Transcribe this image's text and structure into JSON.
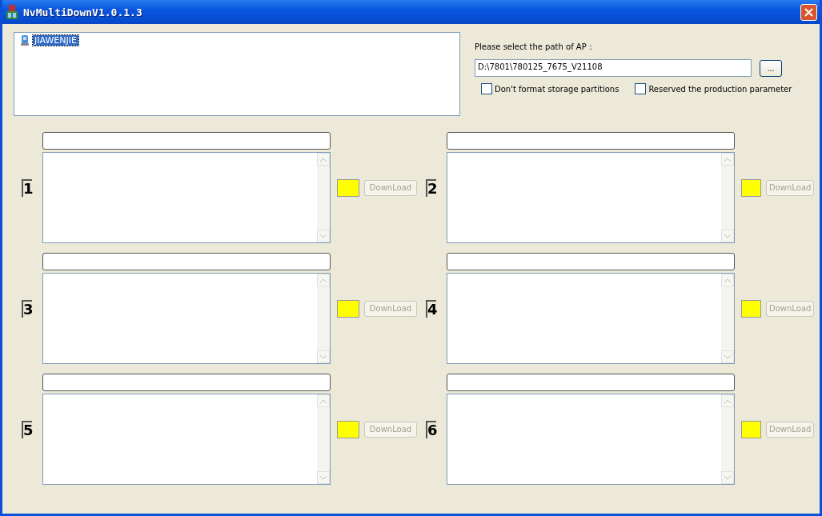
{
  "window": {
    "title": "NvMultiDownV1.0.1.3"
  },
  "devices": [
    {
      "label": "JIAWENJIE",
      "selected": true
    }
  ],
  "path": {
    "label": "Please select the path of AP：",
    "value": "D:\\7801\\780125_7675_V21108",
    "browse": "..."
  },
  "options": [
    {
      "label": "Don't format storage partitions",
      "checked": false
    },
    {
      "label": "Reserved the production parameter",
      "checked": false
    }
  ],
  "ports": [
    {
      "number": "1",
      "color": "#ffff00",
      "button": "DownLoad",
      "disabled": true
    },
    {
      "number": "2",
      "color": "#ffff00",
      "button": "DownLoad",
      "disabled": true
    },
    {
      "number": "3",
      "color": "#ffff00",
      "button": "DownLoad",
      "disabled": true
    },
    {
      "number": "4",
      "color": "#ffff00",
      "button": "DownLoad",
      "disabled": true
    },
    {
      "number": "5",
      "color": "#ffff00",
      "button": "DownLoad",
      "disabled": true
    },
    {
      "number": "6",
      "color": "#ffff00",
      "button": "DownLoad",
      "disabled": true
    }
  ]
}
